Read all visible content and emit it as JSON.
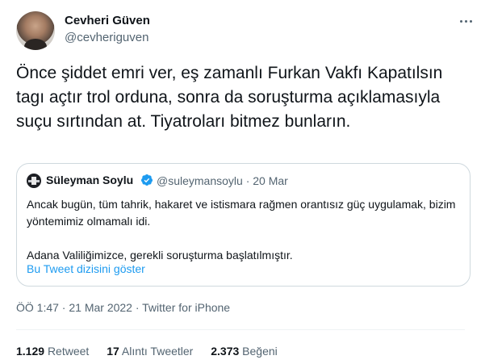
{
  "author": {
    "name": "Cevheri Güven",
    "handle": "@cevheriguven"
  },
  "tweet": {
    "text": "Önce şiddet emri ver, eş zamanlı Furkan Vakfı Kapatılsın tagı açtır trol orduna, sonra da soruşturma açıklamasıyla suçu sırtından at. Tiyatroları bitmez bunların."
  },
  "quoted_tweet": {
    "name": "Süleyman Soylu",
    "handle": "@suleymansoylu",
    "separator": "·",
    "date": "20 Mar",
    "paragraph1": "Ancak bugün, tüm tahrik, hakaret ve istismara rağmen orantısız güç uygulamak, bizim yöntemimiz olmamalı idi.",
    "paragraph2": "Adana Valiliğimizce, gerekli soruşturma başlatılmıştır.",
    "thread_link": "Bu Tweet dizisini göster"
  },
  "meta": {
    "timestamp": "ÖÖ 1:47 · 21 Mar 2022 · Twitter for iPhone"
  },
  "stats": {
    "retweets_count": "1.129",
    "retweets_label": "Retweet",
    "quotes_count": "17",
    "quotes_label": "Alıntı Tweetler",
    "likes_count": "2.373",
    "likes_label": "Beğeni"
  },
  "icons": {
    "more": "more-horizontal-icon",
    "verified": "verified-badge-icon"
  },
  "colors": {
    "accent": "#1d9bf0",
    "secondary_text": "#536471",
    "primary_text": "#0f1419",
    "border": "#cfd9de"
  }
}
